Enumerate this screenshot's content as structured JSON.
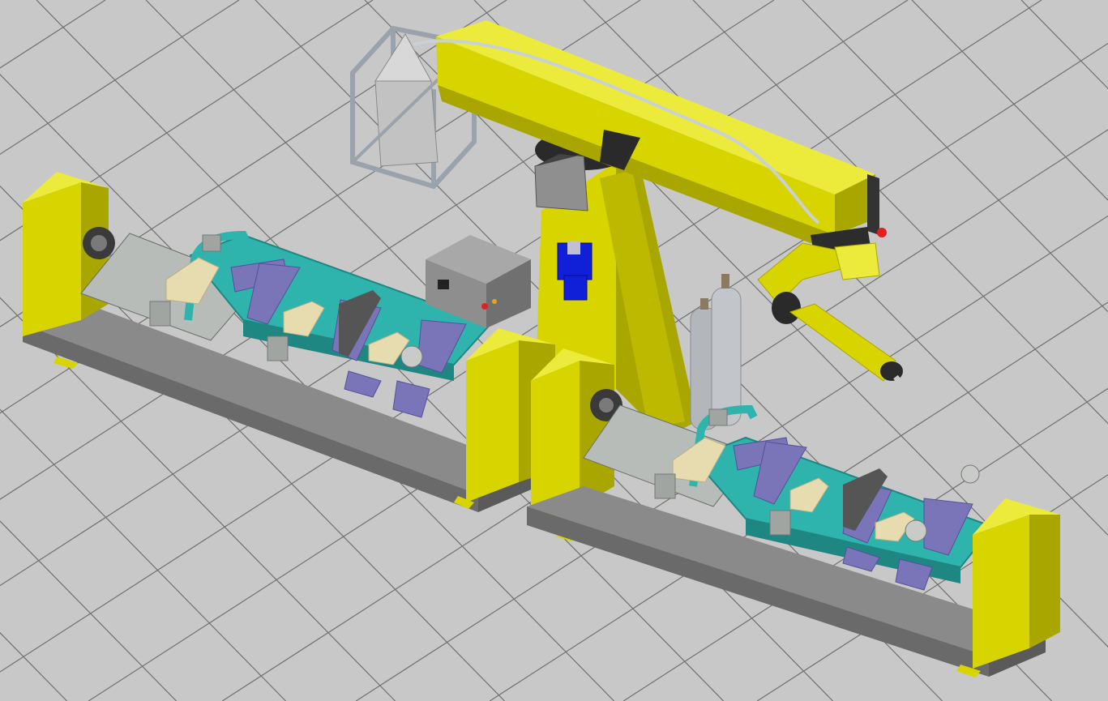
{
  "scene": {
    "kind": "3D CAD render of robotic welding cell",
    "colors": {
      "floor": "#c8c8c8",
      "grid": "#6e6e6e",
      "robot_yellow": "#d8d400",
      "robot_yellow_dark": "#a9a600",
      "robot_yellow_light": "#ecea3a",
      "fixture_teal": "#2fb3ad",
      "fixture_teal_dark": "#1f8782",
      "clamp_purple": "#7a74b8",
      "clamp_purple_dark": "#56509a",
      "wood_block": "#e6dcb0",
      "base_gray": "#7c7c7c",
      "base_gray_dark": "#5c5c5c",
      "plate_gray": "#b7bcb8",
      "cylinder_gray": "#b3b7bc",
      "motor_blue": "#1020d8",
      "control_box": "#8e8e8e"
    },
    "icons": [
      "robot-arm-icon",
      "welding-torch-icon",
      "gas-cylinder-icon",
      "wire-drum-icon",
      "control-box-icon",
      "positioner-icon"
    ]
  }
}
